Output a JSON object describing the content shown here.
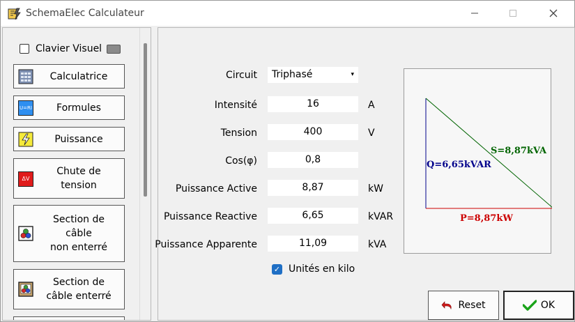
{
  "window": {
    "title": "SchemaElec Calculateur"
  },
  "sidebar": {
    "keyboard_checkbox": {
      "label": "Clavier Visuel",
      "checked": false
    },
    "items": [
      {
        "label": "Calculatrice",
        "icon": "calculator-icon"
      },
      {
        "label": "Formules",
        "icon": "formula-icon",
        "icon_text": "U=RI"
      },
      {
        "label": "Puissance",
        "icon": "lightning-icon"
      },
      {
        "label": "Chute de\ntension",
        "icon": "voltage-drop-icon",
        "icon_text": "ΔV"
      },
      {
        "label": "Section de\ncâble\nnon enterré",
        "icon": "cable-icon"
      },
      {
        "label": "Section de\ncâble enterré",
        "icon": "buried-cable-icon"
      }
    ]
  },
  "form": {
    "circuit": {
      "label": "Circuit",
      "value": "Triphasé"
    },
    "intensite": {
      "label": "Intensité",
      "value": "16",
      "unit": "A"
    },
    "tension": {
      "label": "Tension",
      "value": "400",
      "unit": "V"
    },
    "cos": {
      "label": "Cos(φ)",
      "value": "0,8"
    },
    "p_active": {
      "label": "Puissance Active",
      "value": "8,87",
      "unit": "kW"
    },
    "p_reactive": {
      "label": "Puissance Reactive",
      "value": "6,65",
      "unit": "kVAR"
    },
    "p_apparente": {
      "label": "Puissance Apparente",
      "value": "11,09",
      "unit": "kVA"
    },
    "kilo": {
      "label": "Unités en kilo",
      "checked": true
    }
  },
  "diagram": {
    "p_label": "P=8,87kW",
    "q_label": "Q=6,65kVAR",
    "s_label": "S=8,87kVA",
    "colors": {
      "p": "#cc0000",
      "q": "#00008b",
      "s": "#006400"
    }
  },
  "buttons": {
    "reset": "Reset",
    "ok": "OK"
  }
}
